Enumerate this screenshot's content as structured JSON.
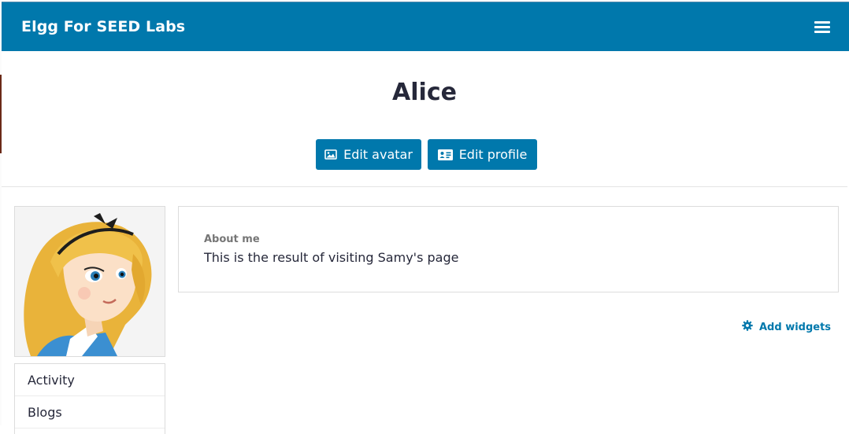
{
  "header": {
    "site_name": "Elgg For SEED Labs",
    "menu_icon": "hamburger-menu-icon"
  },
  "profile": {
    "name": "Alice",
    "avatar_alt": "Alice avatar"
  },
  "actions": {
    "edit_avatar_label": "Edit avatar",
    "edit_avatar_icon": "image-icon",
    "edit_profile_label": "Edit profile",
    "edit_profile_icon": "id-card-icon"
  },
  "about": {
    "label": "About me",
    "text": "This is the result of visiting Samy's page"
  },
  "widgets": {
    "add_label": "Add widgets",
    "add_icon": "gear-icon"
  },
  "sidebar": {
    "items": [
      {
        "label": "Activity"
      },
      {
        "label": "Blogs"
      }
    ]
  },
  "colors": {
    "brand": "#0078ac",
    "text": "#26283a"
  }
}
